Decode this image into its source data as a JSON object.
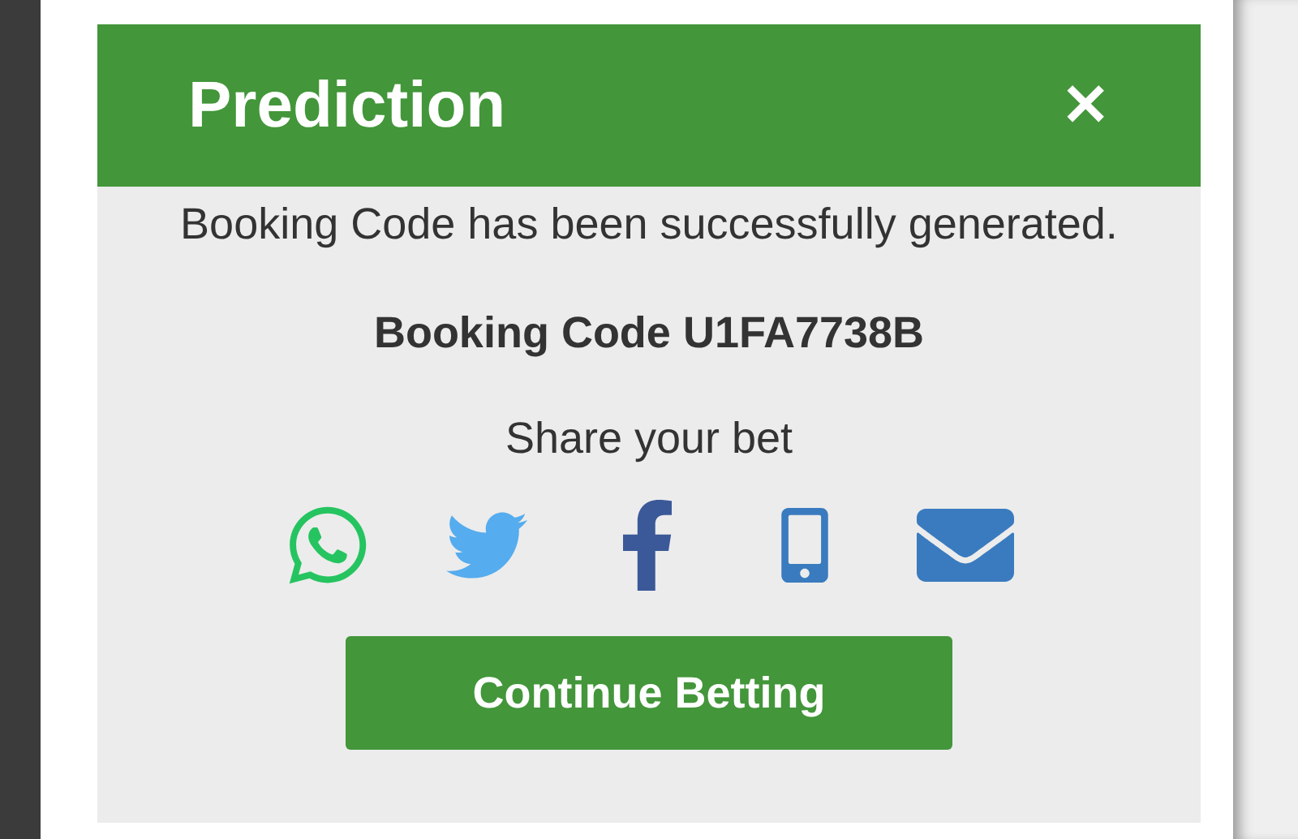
{
  "dialog": {
    "title": "Prediction",
    "close": "✕",
    "message": "Booking Code has been successfully generated.",
    "booking_code": {
      "label": "Booking Code",
      "code": "U1FA7738B"
    },
    "share_label": "Share your bet",
    "button": "Continue Betting"
  }
}
